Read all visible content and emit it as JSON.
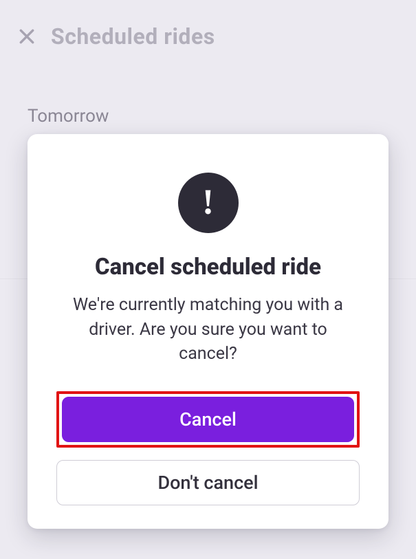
{
  "page": {
    "title": "Scheduled rides",
    "section_label": "Tomorrow"
  },
  "modal": {
    "icon_glyph": "!",
    "title": "Cancel scheduled ride",
    "body": "We're currently matching you with a driver. Are you sure you want to cancel?",
    "primary_label": "Cancel",
    "secondary_label": "Don't cancel"
  },
  "colors": {
    "accent": "#7a1fde",
    "highlight": "#e11313"
  }
}
